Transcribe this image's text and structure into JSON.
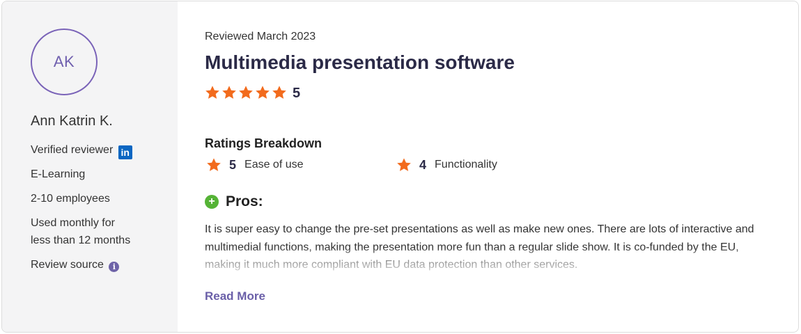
{
  "reviewer": {
    "initials": "AK",
    "name": "Ann Katrin K.",
    "verified_label": "Verified reviewer",
    "linkedin_icon_text": "in",
    "industry": "E-Learning",
    "company_size": "2-10 employees",
    "usage_line1": "Used monthly for",
    "usage_line2": "less than 12 months",
    "review_source_label": "Review source",
    "info_icon_text": "i"
  },
  "review": {
    "date": "Reviewed March 2023",
    "title": "Multimedia presentation software",
    "rating": "5",
    "rating_stars": 5,
    "breakdown_title": "Ratings Breakdown",
    "breakdown": [
      {
        "score": "5",
        "label": "Ease of use"
      },
      {
        "score": "4",
        "label": "Functionality"
      }
    ],
    "pros_label": "Pros:",
    "pros_text": "It is super easy to change the pre-set presentations as well as make new ones. There are lots of interactive and multimedial functions, making the presentation more fun than a regular slide show. It is co-funded by the EU, making it much more compliant with EU data protection than other services.",
    "read_more": "Read More"
  },
  "colors": {
    "star": "#f26b1d",
    "accent": "#6a5fa8",
    "pros_green": "#55b336",
    "linkedin": "#0a66c2"
  }
}
